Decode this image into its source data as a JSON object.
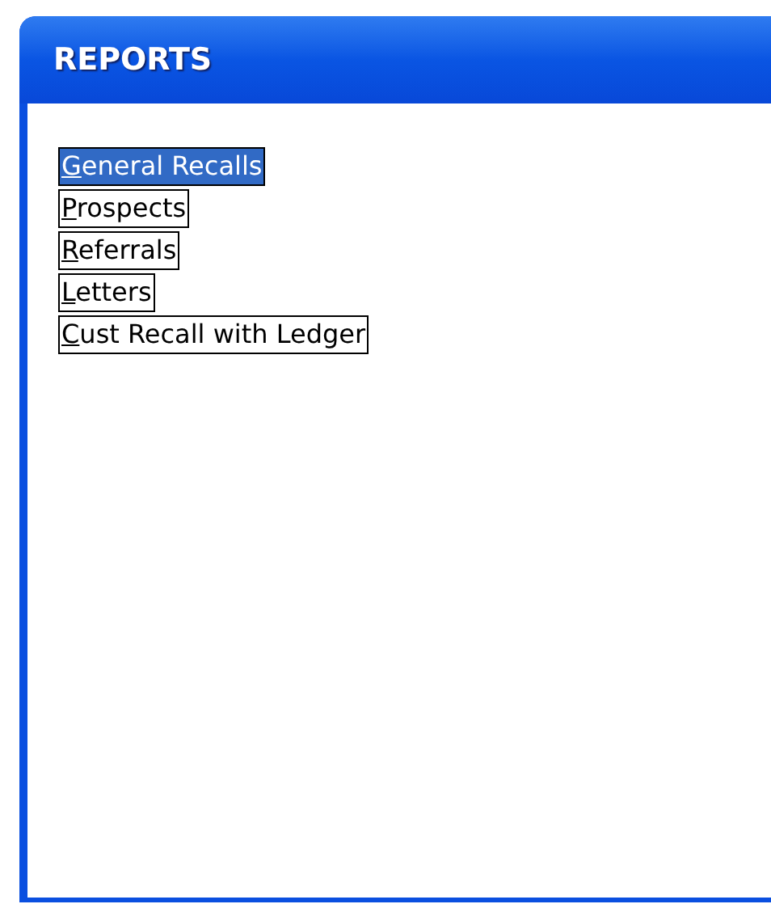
{
  "window": {
    "title": "REPORTS"
  },
  "reports": [
    {
      "label": "General Recalls",
      "selected": true
    },
    {
      "label": "Prospects",
      "selected": false
    },
    {
      "label": "Referrals",
      "selected": false
    },
    {
      "label": "Letters",
      "selected": false
    },
    {
      "label": "Cust Recall with Ledger",
      "selected": false
    }
  ]
}
